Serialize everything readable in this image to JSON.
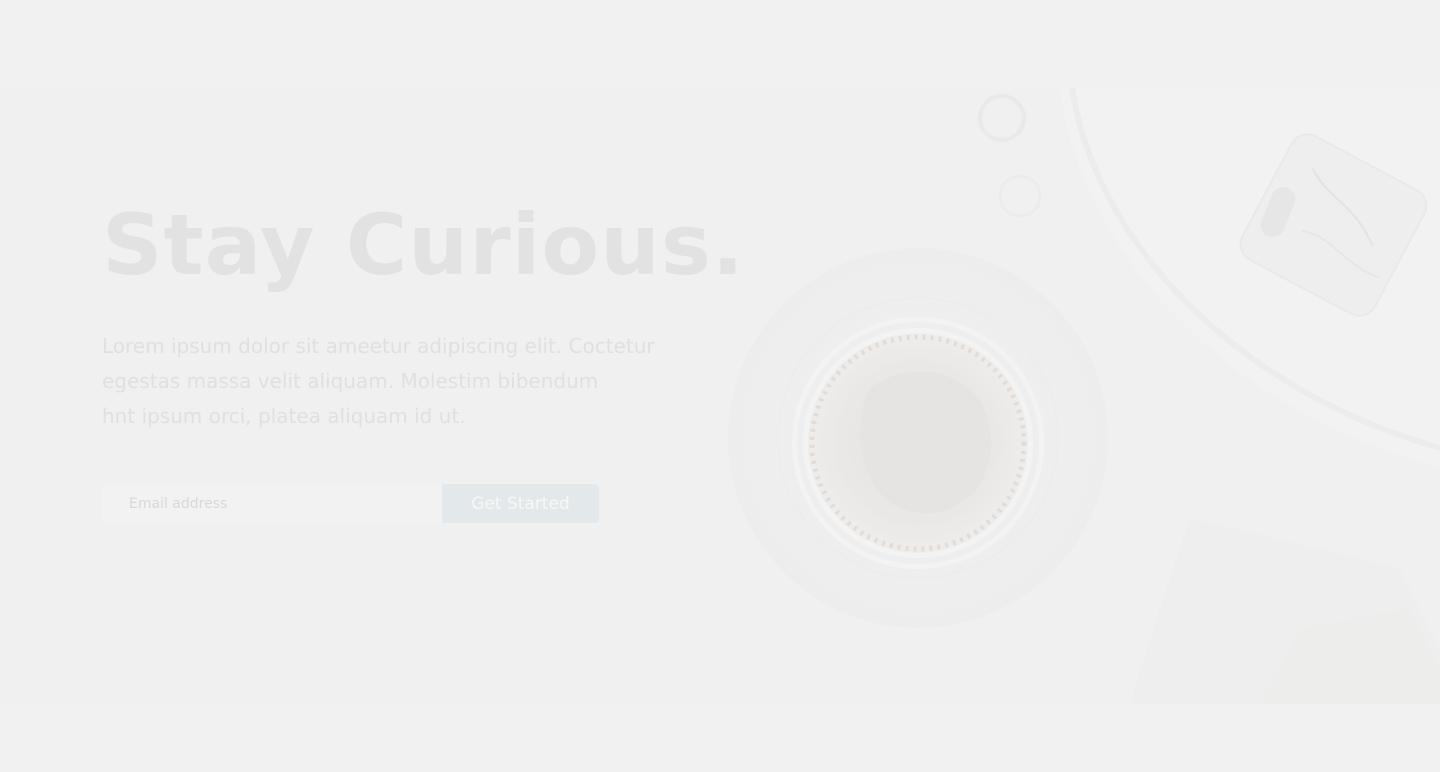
{
  "hero": {
    "headline": "Stay Curious.",
    "lead_lines": [
      "Lorem ipsum dolor sit ameetur adipiscing elit. Coctetur",
      "egestas massa velit aliquam. Molestim bibendum",
      "hnt ipsum orci, platea aliquam id ut."
    ],
    "signup": {
      "email_placeholder": "Email address",
      "email_value": "",
      "button_label": "Get Started"
    },
    "image": "coffee-cup-flatlay"
  },
  "colors": {
    "page_background": "#f1f1f1",
    "hero_background": "#f0f0f0",
    "headline": "#e2e2e2",
    "body_text": "#e0e0e0",
    "button_background": "#e3e9ea",
    "button_text": "#f6f8f8"
  }
}
